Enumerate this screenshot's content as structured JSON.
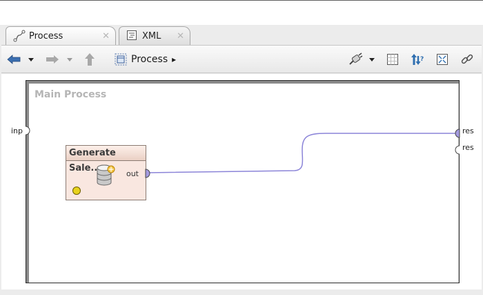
{
  "tabs": [
    {
      "label": "Process",
      "icon": "process-icon",
      "close": "✕"
    },
    {
      "label": "XML",
      "icon": "xml-icon",
      "close": "✕"
    }
  ],
  "toolbar": {
    "breadcrumb_label": "Process",
    "breadcrumb_arrow": "▸"
  },
  "process": {
    "title": "Main Process",
    "input_port": "inp",
    "result_ports": [
      "res",
      "res"
    ]
  },
  "operator": {
    "name": "Generate Sale...",
    "output_port": "out",
    "icon": "database-icon"
  },
  "colors": {
    "wire": "#8b84d8",
    "port_fill": "#a49be0",
    "status_light": "#e7d21c",
    "operator_bg": "#f9e7e0"
  }
}
